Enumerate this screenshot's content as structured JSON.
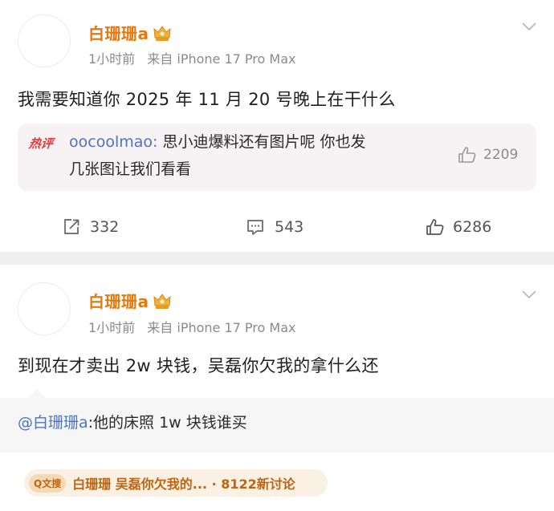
{
  "posts": [
    {
      "username": "白珊珊a",
      "time": "1小时前",
      "source": "来自",
      "device": "iPhone 17 Pro Max",
      "content": "我需要知道你 2025 年 11 月 20 号晚上在干什么",
      "hot_comment": {
        "badge": "热评",
        "user": "oocoolmao:",
        "line1": " 思小迪爆料还有图片呢 你也发",
        "line2": "几张图让我们看看",
        "likes": "2209"
      },
      "actions": {
        "repost": "332",
        "comment": "543",
        "like": "6286"
      }
    },
    {
      "username": "白珊珊a",
      "time": "1小时前",
      "source": "来自",
      "device": "iPhone 17 Pro Max",
      "content": "到现在才卖出 2w 块钱，吴磊你欠我的拿什么还",
      "repost": {
        "mention": "@白珊珊a",
        "text": ":他的床照 1w 块钱谁买"
      },
      "topic": {
        "badge": "Q文搜",
        "text": "白珊珊 吴磊你欠我的... · 8122新讨论"
      }
    }
  ],
  "colors": {
    "username": "#e8780c",
    "link": "#4a74c4",
    "hot_badge": "#e4393c"
  }
}
